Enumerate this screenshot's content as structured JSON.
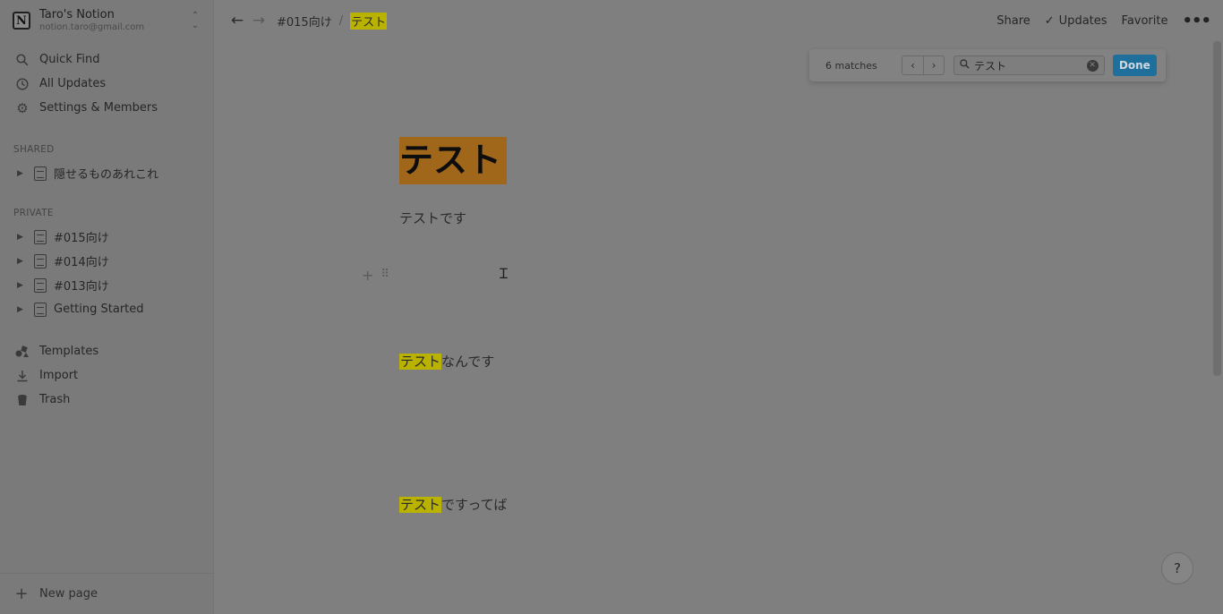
{
  "workspace": {
    "name": "Taro's Notion",
    "email": "notion.taro@gmail.com",
    "logo_letter": "N"
  },
  "sidebar": {
    "nav": [
      {
        "label": "Quick Find",
        "icon": "search-icon"
      },
      {
        "label": "All Updates",
        "icon": "clock-icon"
      },
      {
        "label": "Settings & Members",
        "icon": "gear-icon"
      }
    ],
    "shared_label": "SHARED",
    "shared_pages": [
      {
        "label": "隠せるものあれこれ"
      }
    ],
    "private_label": "PRIVATE",
    "private_pages": [
      {
        "label": "#015向け"
      },
      {
        "label": "#014向け"
      },
      {
        "label": "#013向け"
      },
      {
        "label": "Getting Started"
      }
    ],
    "tools": [
      {
        "label": "Templates",
        "icon": "templates-icon"
      },
      {
        "label": "Import",
        "icon": "import-icon"
      },
      {
        "label": "Trash",
        "icon": "trash-icon"
      }
    ],
    "new_page": "New page"
  },
  "topbar": {
    "breadcrumb": [
      "#015向け",
      "テスト"
    ],
    "separator": "/",
    "share": "Share",
    "updates": "Updates",
    "favorite": "Favorite"
  },
  "find": {
    "matches": "6 matches",
    "query": "テスト",
    "done": "Done"
  },
  "page": {
    "title": "テスト",
    "paragraphs": [
      {
        "highlight": "",
        "text": "テストです"
      },
      {
        "highlight": "テスト",
        "text": "なんです"
      },
      {
        "highlight": "テスト",
        "text": "ですってば"
      }
    ]
  },
  "help": "?"
}
